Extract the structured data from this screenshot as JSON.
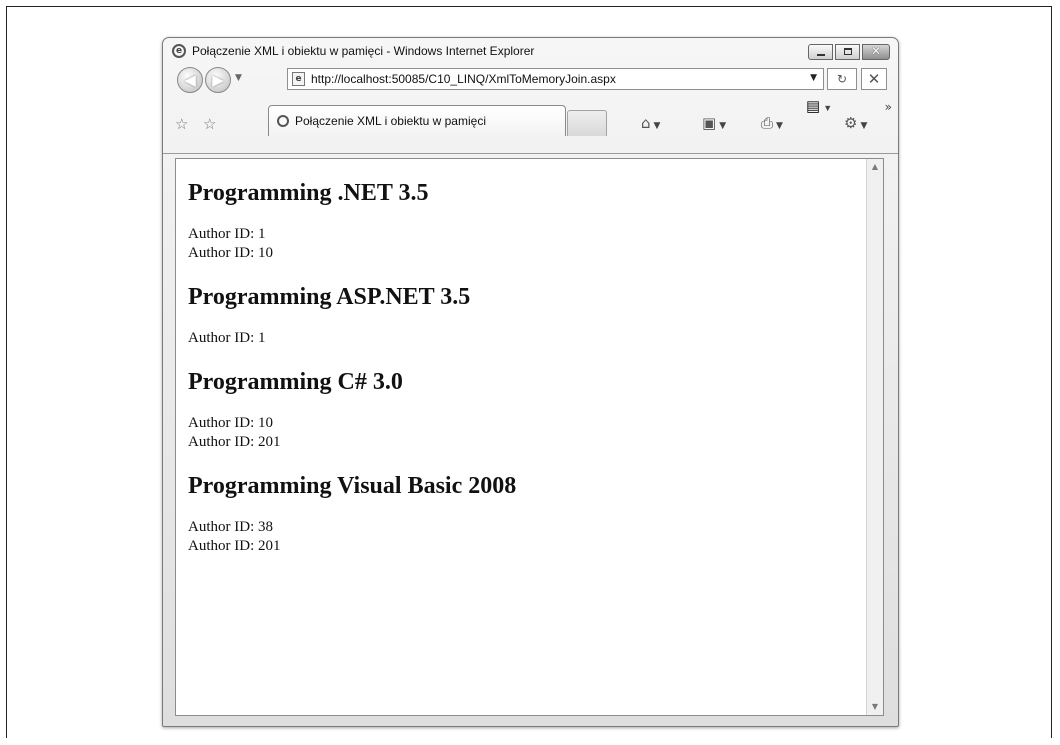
{
  "window": {
    "title": "Połączenie XML i obiektu w pamięci - Windows Internet Explorer",
    "buttons": {
      "minimize": "–",
      "maximize": "□",
      "close": "✕"
    }
  },
  "nav": {
    "back": "◀",
    "forward": "▶",
    "dropdown": "▼",
    "address": "http://localhost:50085/C10_LINQ/XmlToMemoryJoin.aspx",
    "address_dropdown": "▼",
    "refresh": "↻",
    "stop": "✕"
  },
  "tab": {
    "label": "Połączenie XML i obiektu w pamięci"
  },
  "commands": {
    "favorites": "☆",
    "add_favorites": "☆",
    "home": "⌂",
    "feeds": "▣",
    "print": "⎙",
    "page": "▤",
    "tools": "⚙",
    "dropdown": "▼",
    "more": "»"
  },
  "books": [
    {
      "title": "Programming .NET 3.5",
      "authors": [
        "Author ID: 1",
        "Author ID: 10"
      ]
    },
    {
      "title": "Programming ASP.NET 3.5",
      "authors": [
        "Author ID: 1"
      ]
    },
    {
      "title": "Programming C# 3.0",
      "authors": [
        "Author ID: 10",
        "Author ID: 201"
      ]
    },
    {
      "title": "Programming Visual Basic 2008",
      "authors": [
        "Author ID: 38",
        "Author ID: 201"
      ]
    }
  ],
  "scrollbar": {
    "up": "▲",
    "down": "▼"
  },
  "icons": [
    "ie-logo-icon",
    "page-icon",
    "star-icon",
    "home-icon",
    "feeds-icon",
    "print-icon",
    "page-menu-icon",
    "tools-gear-icon"
  ]
}
